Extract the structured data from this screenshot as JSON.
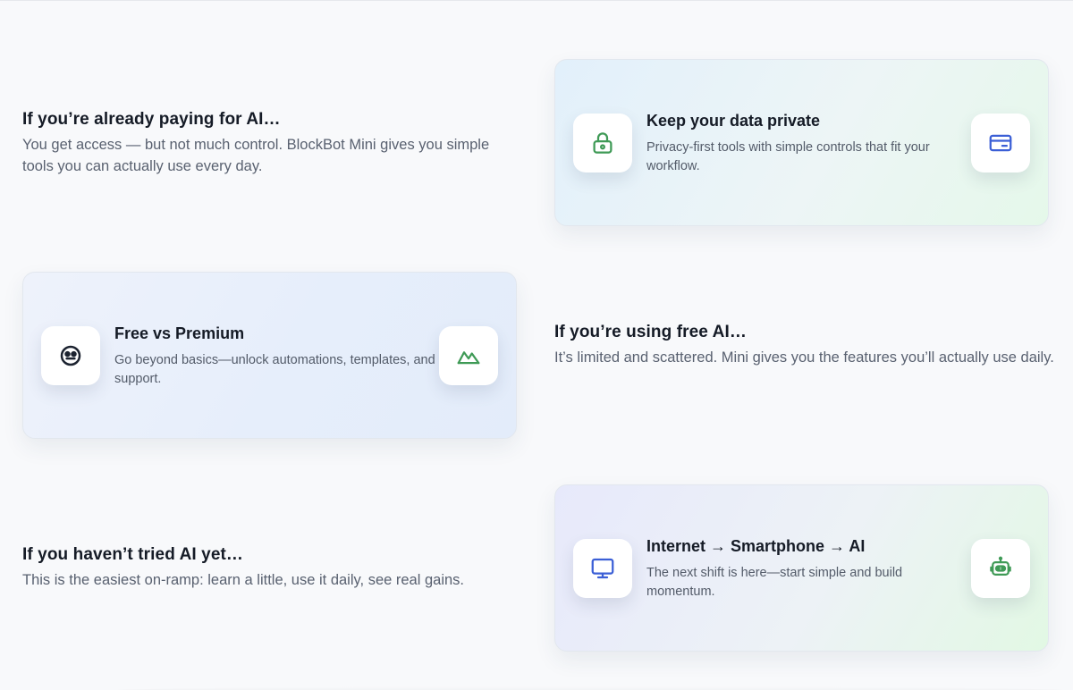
{
  "rows": [
    {
      "text": {
        "title": "If you’re already paying for AI…",
        "body": "You get access — but not much control. BlockBot Mini gives you simple tools you can actually use every day."
      },
      "card": {
        "title": "Keep your data private",
        "body": "Privacy-first tools with simple controls that fit your workflow.",
        "left_icon": "lock-icon",
        "right_icon": "credit-card-icon"
      }
    },
    {
      "card": {
        "title": "Free vs Premium",
        "body": "Go beyond basics—unlock automations, templates, and support.",
        "left_icon": "face-icon",
        "right_icon": "mountain-chart-icon"
      },
      "text": {
        "title": "If you’re using free AI…",
        "body": "It’s limited and scattered. Mini gives you the features you’ll actually use daily."
      }
    },
    {
      "text": {
        "title": "If you haven’t tried AI yet…",
        "body": "This is the easiest on-ramp: learn a little, use it daily, see real gains."
      },
      "card": {
        "title": "Internet → Smartphone → AI",
        "body": "The next shift is here—start simple and build momentum.",
        "left_icon": "monitor-icon",
        "right_icon": "robot-icon"
      }
    }
  ],
  "colors": {
    "green_icon": "#3f9a56",
    "blue_icon": "#3b5fd6",
    "dark_icon": "#1c2330"
  }
}
